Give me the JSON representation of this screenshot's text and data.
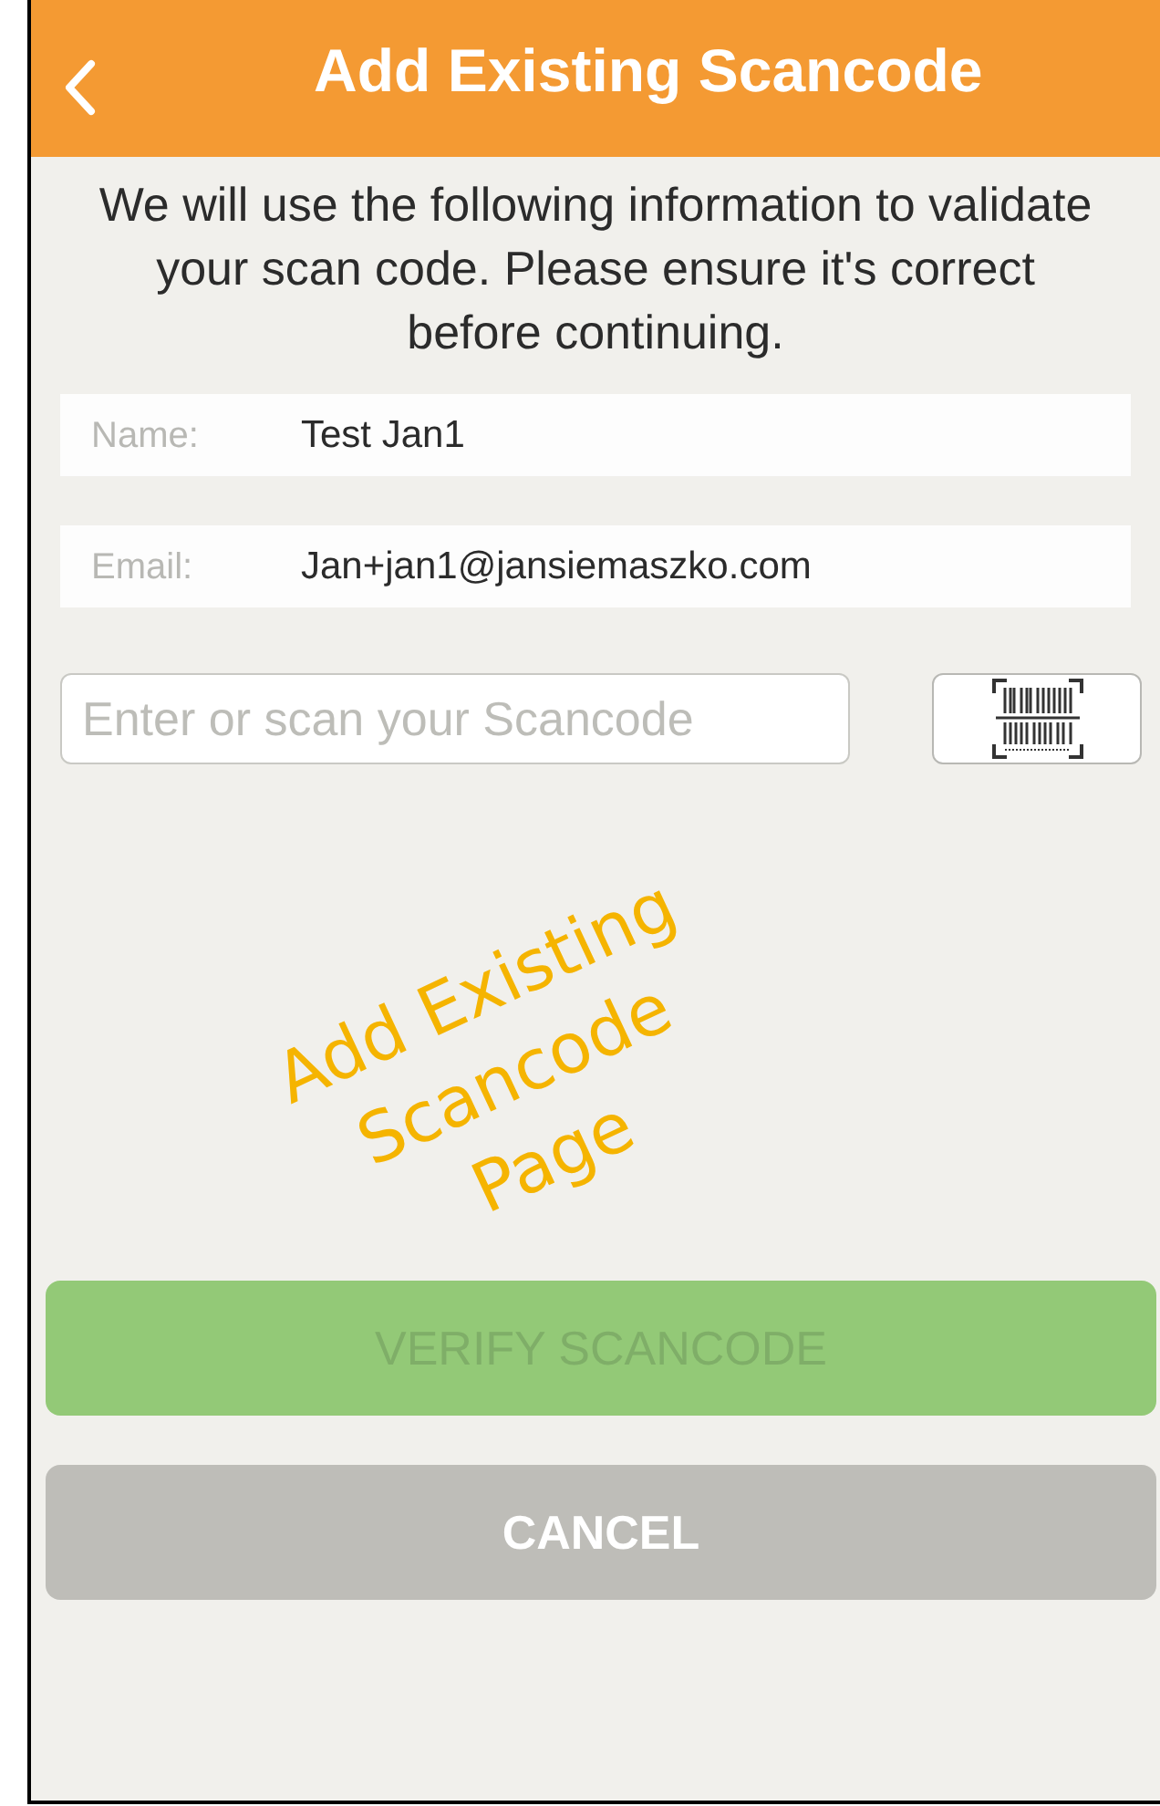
{
  "header": {
    "title": "Add Existing Scancode"
  },
  "intro": "We will use the following information to validate your scan code.  Please ensure it's correct before continuing.",
  "info_rows": [
    {
      "label": "Name:",
      "value": "Test Jan1"
    },
    {
      "label": "Email:",
      "value": "Jan+jan1@jansiemaszko.com"
    }
  ],
  "scancode_field": {
    "placeholder": "Enter or scan your Scancode"
  },
  "annotation": "Add Existing Scancode Page",
  "buttons": [
    {
      "kind": "primary",
      "label": "VERIFY SCANCODE",
      "disabled": true
    },
    {
      "kind": "secondary",
      "label": "CANCEL",
      "disabled": false
    }
  ]
}
